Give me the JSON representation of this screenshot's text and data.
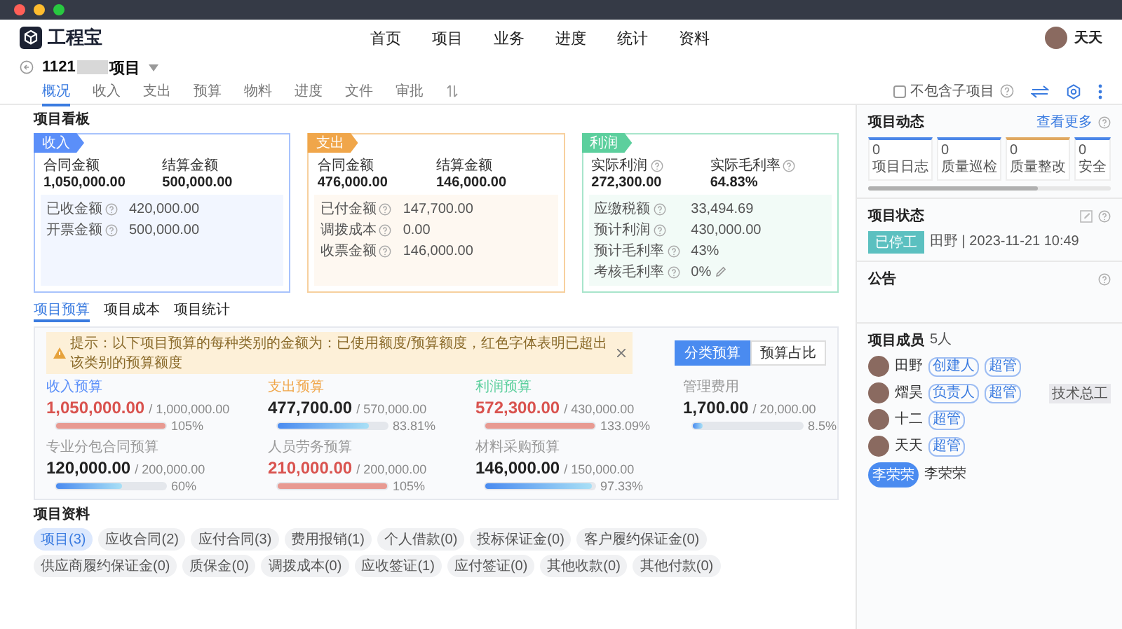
{
  "app": {
    "logo": "工程宝",
    "nav": [
      {
        "label": "首页"
      },
      {
        "label": "项目"
      },
      {
        "label": "业务"
      },
      {
        "label": "进度"
      },
      {
        "label": "统计"
      },
      {
        "label": "资料"
      }
    ],
    "user": {
      "name": "天天"
    }
  },
  "project": {
    "name_start": "1121",
    "name_end": "项目",
    "tabs": [
      {
        "label": "概况",
        "selected": true
      },
      {
        "label": "收入",
        "selected": false
      },
      {
        "label": "支出",
        "selected": false
      },
      {
        "label": "预算",
        "selected": false
      },
      {
        "label": "物料",
        "selected": false
      },
      {
        "label": "进度",
        "selected": false
      },
      {
        "label": "文件",
        "selected": false
      },
      {
        "label": "审批",
        "selected": false
      }
    ],
    "exclude_sub": {
      "label": "不包含子项目",
      "checked": false
    }
  },
  "board": {
    "title": "项目看板",
    "cards": [
      {
        "tag": "收入",
        "color": "#5b8ff9",
        "metrics": [
          {
            "label": "合同金额",
            "value": "1,050,000.00",
            "help": false
          },
          {
            "label": "结算金额",
            "value": "500,000.00",
            "help": false
          }
        ],
        "rows": [
          {
            "label": "已收金额",
            "value": "420,000.00",
            "editable": false
          },
          {
            "label": "开票金额",
            "value": "500,000.00",
            "editable": false
          }
        ]
      },
      {
        "tag": "支出",
        "color": "#f0a64a",
        "metrics": [
          {
            "label": "合同金额",
            "value": "476,000.00",
            "help": false
          },
          {
            "label": "结算金额",
            "value": "146,000.00",
            "help": false
          }
        ],
        "rows": [
          {
            "label": "已付金额",
            "value": "147,700.00",
            "editable": false
          },
          {
            "label": "调拨成本",
            "value": "0.00",
            "editable": false
          },
          {
            "label": "收票金额",
            "value": "146,000.00",
            "editable": false
          }
        ]
      },
      {
        "tag": "利润",
        "color": "#5ccf9d",
        "metrics": [
          {
            "label": "实际利润",
            "value": "272,300.00",
            "help": true
          },
          {
            "label": "实际毛利率",
            "value": "64.83%",
            "help": true
          }
        ],
        "rows": [
          {
            "label": "应缴税额",
            "value": "33,494.69",
            "editable": false
          },
          {
            "label": "预计利润",
            "value": "430,000.00",
            "editable": false
          },
          {
            "label": "预计毛利率",
            "value": "43%",
            "editable": false
          },
          {
            "label": "考核毛利率",
            "value": "0%",
            "editable": true
          }
        ]
      }
    ]
  },
  "budget": {
    "tabs": [
      {
        "label": "项目预算",
        "selected": true
      },
      {
        "label": "项目成本",
        "selected": false
      },
      {
        "label": "项目统计",
        "selected": false
      }
    ],
    "notice": "提示：以下项目预算的每种类别的金额为：已使用额度/预算额度，红色字体表明已超出该类别的预算额度",
    "modes": [
      {
        "label": "分类预算",
        "selected": true
      },
      {
        "label": "预算占比",
        "selected": false
      }
    ],
    "items": [
      {
        "label": "收入预算",
        "color": "#5b8ff9",
        "used": "1,050,000.00",
        "total": "/ 1,000,000.00",
        "over": true,
        "level": 1,
        "percent": "105%"
      },
      {
        "label": "支出预算",
        "color": "#f0a64a",
        "used": "477,700.00",
        "total": "/ 570,000.00",
        "over": false,
        "level": 0.8381,
        "percent": "83.81%"
      },
      {
        "label": "利润预算",
        "color": "#5ccf9d",
        "used": "572,300.00",
        "total": "/ 430,000.00",
        "over": true,
        "level": 1,
        "percent": "133.09%"
      },
      {
        "label": "管理费用",
        "color": "#999999",
        "used": "1,700.00",
        "total": "/ 20,000.00",
        "over": false,
        "level": 0.085,
        "percent": "8.5%"
      },
      {
        "label": "专业分包合同预算",
        "color": "#999999",
        "used": "120,000.00",
        "total": "/ 200,000.00",
        "over": false,
        "level": 0.6,
        "percent": "60%"
      },
      {
        "label": "人员劳务预算",
        "color": "#999999",
        "used": "210,000.00",
        "total": "/ 200,000.00",
        "over": true,
        "level": 1,
        "percent": "105%"
      },
      {
        "label": "材料采购预算",
        "color": "#999999",
        "used": "146,000.00",
        "total": "/ 150,000.00",
        "over": false,
        "level": 0.9733,
        "percent": "97.33%"
      }
    ]
  },
  "materials": {
    "title": "项目资料",
    "tags": [
      {
        "label": "项目(3)",
        "selected": true
      },
      {
        "label": "应收合同(2)",
        "selected": false
      },
      {
        "label": "应付合同(3)",
        "selected": false
      },
      {
        "label": "费用报销(1)",
        "selected": false
      },
      {
        "label": "个人借款(0)",
        "selected": false
      },
      {
        "label": "投标保证金(0)",
        "selected": false
      },
      {
        "label": "客户履约保证金(0)",
        "selected": false
      },
      {
        "label": "供应商履约保证金(0)",
        "selected": false
      },
      {
        "label": "质保金(0)",
        "selected": false
      },
      {
        "label": "调拨成本(0)",
        "selected": false
      },
      {
        "label": "应收签证(1)",
        "selected": false
      },
      {
        "label": "应付签证(0)",
        "selected": false
      },
      {
        "label": "其他收款(0)",
        "selected": false
      },
      {
        "label": "其他付款(0)",
        "selected": false
      }
    ]
  },
  "sidebar": {
    "activity": {
      "title": "项目动态",
      "more": "查看更多",
      "stats": [
        {
          "count": "0",
          "label": "项目日志",
          "color": "#4a86e8"
        },
        {
          "count": "0",
          "label": "质量巡检",
          "color": "#4a86e8"
        },
        {
          "count": "0",
          "label": "质量整改",
          "color": "#e0a860"
        },
        {
          "count": "0",
          "label": "安全",
          "color": "#4a86e8"
        }
      ]
    },
    "status": {
      "title": "项目状态",
      "badge": "已停工",
      "meta": "田野 | 2023-11-21 10:49"
    },
    "notice": {
      "title": "公告"
    },
    "members": {
      "title": "项目成员",
      "count": "5人",
      "items": [
        {
          "name": "田野",
          "roles": [
            "创建人",
            "超管"
          ]
        },
        {
          "name": "熠昊",
          "roles": [
            "负责人",
            "超管"
          ],
          "position": "技术总工"
        },
        {
          "name": "十二",
          "roles": [
            "超管"
          ]
        },
        {
          "name": "天天",
          "roles": [
            "超管"
          ]
        },
        {
          "name": "李荣荣",
          "avatar_text": "李荣荣"
        }
      ]
    }
  }
}
